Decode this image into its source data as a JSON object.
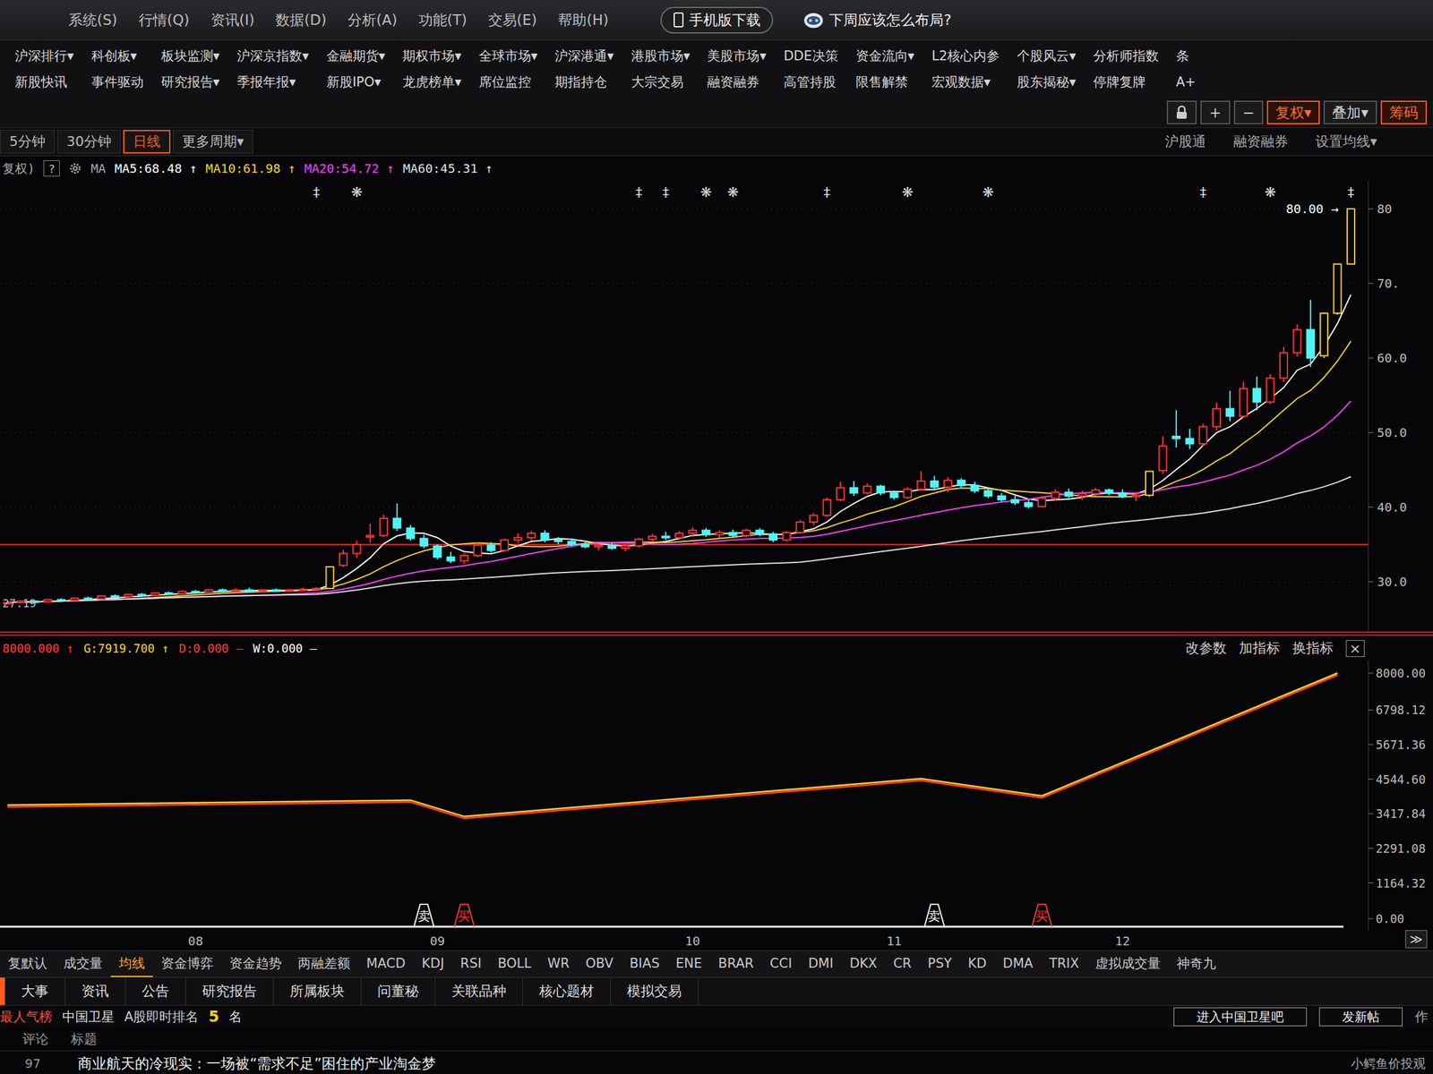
{
  "menu": {
    "items": [
      "系统(S)",
      "行情(Q)",
      "资讯(I)",
      "数据(D)",
      "分析(A)",
      "功能(T)",
      "交易(E)",
      "帮助(H)"
    ],
    "promos": [
      {
        "label": "手机版下载",
        "kind": "phone"
      },
      {
        "label": "下周应该怎么布局?",
        "kind": "robot"
      }
    ]
  },
  "nav_rows": [
    [
      "沪深排行▾",
      "科创板▾",
      "板块监测▾",
      "沪深京指数▾",
      "金融期货▾",
      "期权市场▾",
      "全球市场▾",
      "沪深港通▾",
      "港股市场▾",
      "美股市场▾",
      "DDE决策",
      "资金流向▾",
      "L2核心内参",
      "个股风云▾",
      "分析师指数",
      "条"
    ],
    [
      "新股快讯",
      "事件驱动",
      "研究报告▾",
      "季报年报▾",
      "新股IPO▾",
      "龙虎榜单▾",
      "席位监控",
      "期指持仓",
      "大宗交易",
      "融资融券",
      "高管持股",
      "限售解禁",
      "宏观数据▾",
      "股东揭秘▾",
      "停牌复牌",
      "A+"
    ]
  ],
  "tools": [
    {
      "kind": "lock",
      "label": "",
      "selected": false
    },
    {
      "kind": "text",
      "label": "+",
      "selected": false
    },
    {
      "kind": "text",
      "label": "−",
      "selected": false
    },
    {
      "kind": "text",
      "label": "复权▾",
      "selected": true
    },
    {
      "kind": "text",
      "label": "叠加▾",
      "selected": false
    },
    {
      "kind": "text",
      "label": "筹码",
      "selected": true
    }
  ],
  "periods": [
    {
      "label": "5分钟",
      "selected": false
    },
    {
      "label": "30分钟",
      "selected": false
    },
    {
      "label": "日线",
      "selected": true
    },
    {
      "label": "更多周期▾",
      "selected": false
    }
  ],
  "period_links": [
    "沪股通",
    "融资融券",
    "设置均线▾"
  ],
  "ma_legend": {
    "prefix": "复权)",
    "help": "?",
    "ma": "MA",
    "items": [
      {
        "label": "MA5:68.48",
        "arrow": "↑",
        "color": "#ffffff",
        "period": 5
      },
      {
        "label": "MA10:61.98",
        "arrow": "↑",
        "color": "#ffd21f",
        "period": 10
      },
      {
        "label": "MA20:54.72",
        "arrow": "↑",
        "color": "#ff3cff",
        "period": 20
      },
      {
        "label": "MA60:45.31",
        "arrow": "↑",
        "color": "#e0e0e0",
        "period": 60
      }
    ]
  },
  "chart": {
    "ticks": [
      {
        "label": "80",
        "value": 80
      },
      {
        "label": "70.",
        "value": 70
      },
      {
        "label": "60.0",
        "value": 60
      },
      {
        "label": "50.0",
        "value": 50
      },
      {
        "label": "40.0",
        "value": 40
      },
      {
        "label": "30.0",
        "value": 30
      }
    ],
    "support_line": 35,
    "low_mark": {
      "label": "27.19",
      "value": 27.19
    },
    "high_mark": {
      "label": "80.00",
      "arrow": "→",
      "value": 80
    },
    "candles": [
      [
        27.1,
        27.4,
        27.0,
        27.2
      ],
      [
        27.2,
        27.5,
        27.1,
        27.4
      ],
      [
        27.4,
        27.6,
        27.2,
        27.3
      ],
      [
        27.3,
        27.7,
        27.2,
        27.6
      ],
      [
        27.6,
        27.8,
        27.4,
        27.5
      ],
      [
        27.5,
        27.9,
        27.4,
        27.8
      ],
      [
        27.8,
        28.0,
        27.6,
        27.7
      ],
      [
        27.7,
        28.2,
        27.6,
        28.1
      ],
      [
        28.1,
        28.3,
        27.9,
        28.0
      ],
      [
        28.0,
        28.4,
        27.9,
        28.3
      ],
      [
        28.3,
        28.5,
        28.1,
        28.2
      ],
      [
        28.2,
        28.6,
        28.1,
        28.5
      ],
      [
        28.5,
        28.7,
        28.3,
        28.4
      ],
      [
        28.4,
        28.8,
        28.3,
        28.7
      ],
      [
        28.7,
        28.9,
        28.5,
        28.6
      ],
      [
        28.6,
        29.0,
        28.5,
        28.9
      ],
      [
        28.9,
        29.1,
        28.7,
        28.8
      ],
      [
        28.8,
        29.1,
        28.6,
        28.9
      ],
      [
        28.9,
        29.2,
        28.7,
        28.8
      ],
      [
        28.8,
        29.0,
        28.6,
        28.9
      ],
      [
        28.9,
        29.1,
        28.7,
        28.8
      ],
      [
        28.8,
        29.0,
        28.6,
        28.9
      ],
      [
        28.9,
        29.2,
        28.7,
        29.0
      ],
      [
        29.0,
        29.3,
        28.8,
        29.1
      ],
      [
        29.1,
        32.0,
        29.0,
        32.0
      ],
      [
        32.2,
        34.3,
        32.0,
        33.8
      ],
      [
        33.8,
        35.5,
        33.2,
        35.0
      ],
      [
        36.0,
        37.8,
        35.2,
        36.2
      ],
      [
        36.2,
        39.0,
        36.0,
        38.5
      ],
      [
        38.5,
        40.5,
        36.8,
        37.2
      ],
      [
        37.2,
        37.6,
        35.5,
        35.8
      ],
      [
        35.8,
        36.3,
        34.5,
        34.8
      ],
      [
        34.8,
        35.0,
        33.0,
        33.3
      ],
      [
        33.3,
        34.0,
        32.5,
        32.8
      ],
      [
        32.8,
        33.8,
        32.4,
        33.5
      ],
      [
        33.5,
        35.2,
        33.3,
        34.9
      ],
      [
        34.9,
        35.3,
        33.9,
        34.2
      ],
      [
        34.2,
        35.8,
        34.0,
        35.6
      ],
      [
        35.6,
        36.5,
        35.2,
        35.9
      ],
      [
        35.9,
        36.8,
        35.5,
        36.5
      ],
      [
        36.5,
        36.9,
        35.3,
        35.6
      ],
      [
        35.6,
        36.0,
        35.0,
        35.4
      ],
      [
        35.4,
        35.8,
        34.8,
        35.0
      ],
      [
        35.0,
        35.5,
        34.5,
        34.7
      ],
      [
        34.7,
        35.1,
        34.2,
        34.9
      ],
      [
        34.9,
        35.2,
        34.3,
        34.5
      ],
      [
        34.5,
        35.0,
        34.1,
        34.8
      ],
      [
        34.8,
        35.9,
        34.6,
        35.7
      ],
      [
        35.7,
        36.4,
        35.3,
        36.1
      ],
      [
        36.1,
        36.7,
        35.6,
        35.9
      ],
      [
        35.9,
        36.8,
        35.7,
        36.5
      ],
      [
        36.5,
        37.3,
        36.0,
        36.9
      ],
      [
        36.9,
        37.2,
        36.0,
        36.3
      ],
      [
        36.3,
        36.9,
        35.9,
        36.6
      ],
      [
        36.6,
        37.0,
        36.0,
        36.2
      ],
      [
        36.2,
        37.1,
        36.0,
        36.9
      ],
      [
        36.9,
        37.2,
        36.1,
        36.4
      ],
      [
        36.4,
        36.7,
        35.3,
        35.6
      ],
      [
        35.6,
        36.8,
        35.4,
        36.6
      ],
      [
        36.6,
        38.3,
        36.4,
        38.0
      ],
      [
        38.0,
        39.2,
        37.6,
        38.9
      ],
      [
        38.9,
        41.3,
        38.7,
        41.0
      ],
      [
        41.0,
        43.4,
        40.8,
        42.6
      ],
      [
        42.6,
        43.5,
        41.5,
        41.9
      ],
      [
        41.9,
        43.2,
        41.7,
        42.8
      ],
      [
        42.8,
        43.0,
        41.6,
        41.9
      ],
      [
        41.9,
        42.2,
        41.0,
        41.3
      ],
      [
        41.3,
        42.7,
        41.1,
        42.4
      ],
      [
        42.4,
        44.8,
        42.2,
        43.5
      ],
      [
        43.5,
        44.2,
        42.3,
        42.7
      ],
      [
        42.7,
        44.0,
        42.0,
        43.6
      ],
      [
        43.6,
        43.9,
        42.5,
        42.9
      ],
      [
        42.9,
        43.4,
        41.9,
        42.2
      ],
      [
        42.2,
        42.6,
        41.2,
        41.5
      ],
      [
        41.5,
        41.9,
        40.7,
        41.0
      ],
      [
        41.0,
        41.5,
        40.3,
        40.6
      ],
      [
        40.6,
        41.0,
        39.8,
        40.1
      ],
      [
        40.1,
        41.5,
        40.0,
        41.2
      ],
      [
        41.2,
        42.4,
        40.9,
        42.0
      ],
      [
        42.0,
        42.5,
        41.2,
        41.5
      ],
      [
        41.5,
        42.2,
        41.0,
        41.8
      ],
      [
        41.8,
        42.6,
        41.5,
        42.3
      ],
      [
        42.3,
        42.5,
        41.6,
        41.9
      ],
      [
        41.9,
        42.4,
        41.2,
        41.4
      ],
      [
        41.4,
        42.0,
        40.8,
        41.6
      ],
      [
        41.6,
        44.8,
        41.4,
        44.8
      ],
      [
        44.9,
        49.5,
        44.5,
        48.2
      ],
      [
        49.5,
        53.0,
        48.0,
        49.2
      ],
      [
        49.2,
        50.5,
        47.8,
        48.5
      ],
      [
        48.5,
        51.2,
        48.2,
        50.8
      ],
      [
        50.8,
        54.0,
        50.3,
        53.2
      ],
      [
        53.2,
        55.6,
        51.5,
        52.2
      ],
      [
        52.2,
        56.8,
        52.0,
        55.9
      ],
      [
        55.9,
        57.5,
        53.0,
        54.1
      ],
      [
        54.1,
        57.8,
        53.8,
        57.3
      ],
      [
        57.3,
        61.5,
        56.8,
        60.7
      ],
      [
        60.7,
        64.5,
        60.2,
        63.8
      ],
      [
        63.8,
        67.8,
        58.8,
        60.0
      ],
      [
        60.3,
        66.0,
        60.0,
        66.0
      ],
      [
        66.0,
        72.6,
        65.8,
        72.6
      ],
      [
        72.6,
        80.0,
        72.6,
        80.0
      ]
    ],
    "limit_up": [
      24,
      85,
      98,
      99,
      100
    ],
    "events": [
      {
        "i": 23,
        "glyph": "‡"
      },
      {
        "i": 26,
        "glyph": "❋"
      },
      {
        "i": 47,
        "glyph": "‡"
      },
      {
        "i": 49,
        "glyph": "‡"
      },
      {
        "i": 52,
        "glyph": "❋"
      },
      {
        "i": 54,
        "glyph": "❋"
      },
      {
        "i": 61,
        "glyph": "‡"
      },
      {
        "i": 67,
        "glyph": "❋"
      },
      {
        "i": 73,
        "glyph": "❋"
      },
      {
        "i": 89,
        "glyph": "‡"
      },
      {
        "i": 94,
        "glyph": "❋"
      },
      {
        "i": 100,
        "glyph": "‡"
      }
    ]
  },
  "indicator": {
    "legend": [
      {
        "label": "8000.000",
        "arrow": "↑",
        "color": "#ff3b3b"
      },
      {
        "label": "G:7919.700",
        "arrow": "↑",
        "color": "#ffd21f"
      },
      {
        "label": "D:0.000",
        "arrow": "—",
        "color": "#ff3b3b"
      },
      {
        "label": "W:0.000",
        "arrow": "—",
        "color": "#ffffff"
      }
    ],
    "actions": [
      "改参数",
      "加指标",
      "换指标",
      "×"
    ],
    "ticks": [
      {
        "label": "8000.00",
        "value": 8000
      },
      {
        "label": "6798.12",
        "value": 6798.12
      },
      {
        "label": "5671.36",
        "value": 5671.36
      },
      {
        "label": "4544.60",
        "value": 4544.6
      },
      {
        "label": "3417.84",
        "value": 3417.84
      },
      {
        "label": "2291.08",
        "value": 2291.08
      },
      {
        "label": "1164.32",
        "value": 1164.32
      },
      {
        "label": "0.00",
        "value": 0
      }
    ],
    "line": [
      {
        "i": 0,
        "v": 3700
      },
      {
        "i": 30,
        "v": 3860
      },
      {
        "i": 34,
        "v": 3330
      },
      {
        "i": 68,
        "v": 4560
      },
      {
        "i": 77,
        "v": 4000
      },
      {
        "i": 99,
        "v": 8000
      }
    ],
    "signals": [
      {
        "i": 31,
        "label": "卖",
        "kind": "sell"
      },
      {
        "i": 34,
        "label": "买",
        "kind": "buy"
      },
      {
        "i": 69,
        "label": "卖",
        "kind": "sell"
      },
      {
        "i": 77,
        "label": "买",
        "kind": "buy"
      }
    ],
    "x_labels": [
      {
        "label": "08",
        "i": 14
      },
      {
        "label": "09",
        "i": 32
      },
      {
        "label": "10",
        "i": 51
      },
      {
        "label": "11",
        "i": 66
      },
      {
        "label": "12",
        "i": 83
      }
    ],
    "scroll": "≫"
  },
  "indicator_tabs": [
    {
      "label": "复默认",
      "selected": false
    },
    {
      "label": "成交量",
      "selected": false
    },
    {
      "label": "均线",
      "selected": true
    },
    {
      "label": "资金博弈",
      "selected": false
    },
    {
      "label": "资金趋势",
      "selected": false
    },
    {
      "label": "两融差额",
      "selected": false
    },
    {
      "label": "MACD",
      "selected": false
    },
    {
      "label": "KDJ",
      "selected": false
    },
    {
      "label": "RSI",
      "selected": false
    },
    {
      "label": "BOLL",
      "selected": false
    },
    {
      "label": "WR",
      "selected": false
    },
    {
      "label": "OBV",
      "selected": false
    },
    {
      "label": "BIAS",
      "selected": false
    },
    {
      "label": "ENE",
      "selected": false
    },
    {
      "label": "BRAR",
      "selected": false
    },
    {
      "label": "CCI",
      "selected": false
    },
    {
      "label": "DMI",
      "selected": false
    },
    {
      "label": "DKX",
      "selected": false
    },
    {
      "label": "CR",
      "selected": false
    },
    {
      "label": "PSY",
      "selected": false
    },
    {
      "label": "KD",
      "selected": false
    },
    {
      "label": "DMA",
      "selected": false
    },
    {
      "label": "TRIX",
      "selected": false
    },
    {
      "label": "虚拟成交量",
      "selected": false
    },
    {
      "label": "神奇九",
      "selected": false
    }
  ],
  "info_tabs": [
    {
      "label": "大事",
      "selected": true
    },
    {
      "label": "资讯",
      "selected": false
    },
    {
      "label": "公告",
      "selected": false
    },
    {
      "label": "研究报告",
      "selected": false
    },
    {
      "label": "所属板块",
      "selected": false
    },
    {
      "label": "问董秘",
      "selected": false
    },
    {
      "label": "关联品种",
      "selected": false
    },
    {
      "label": "核心题材",
      "selected": false
    },
    {
      "label": "模拟交易",
      "selected": false
    }
  ],
  "hot_bar": {
    "title": "最人气榜",
    "stock": "中国卫星",
    "rank_label": "A股即时排名",
    "rank": "5",
    "rank_unit": "名",
    "buttons": [
      "进入中国卫星吧",
      "发新帖"
    ],
    "edge": "作"
  },
  "comments": {
    "columns": [
      "评论",
      "标题"
    ],
    "rows": [
      {
        "count": "97",
        "title": "商业航天的冷现实：一场被“需求不足”困住的产业淘金梦"
      }
    ]
  },
  "watermark": "小鳄鱼价投观"
}
